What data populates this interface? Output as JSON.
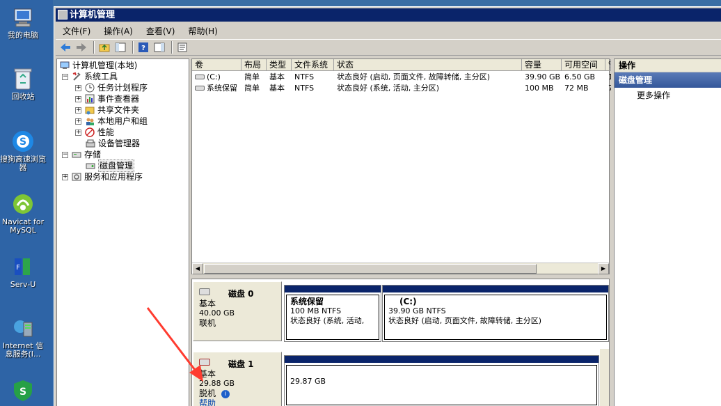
{
  "desktop": {
    "icons": [
      {
        "label": "我的电脑",
        "icon": "computer-icon"
      },
      {
        "label": "回收站",
        "icon": "recycle-bin-icon"
      },
      {
        "label": "搜狗高速浏览器",
        "icon": "sogou-browser-icon"
      },
      {
        "label": "Navicat for MySQL",
        "icon": "navicat-icon"
      },
      {
        "label": "Serv-U",
        "icon": "servu-icon"
      },
      {
        "label": "Internet 信息服务(I...",
        "icon": "iis-icon"
      },
      {
        "label": "",
        "icon": "security-shield-icon"
      }
    ]
  },
  "window": {
    "title": "计算机管理",
    "menu": [
      "文件(F)",
      "操作(A)",
      "查看(V)",
      "帮助(H)"
    ]
  },
  "tree": {
    "root": "计算机管理(本地)",
    "items": [
      {
        "label": "系统工具",
        "level": 1,
        "expander": "⊟"
      },
      {
        "label": "任务计划程序",
        "level": 2,
        "expander": "⊞"
      },
      {
        "label": "事件查看器",
        "level": 2,
        "expander": "⊞"
      },
      {
        "label": "共享文件夹",
        "level": 2,
        "expander": "⊞"
      },
      {
        "label": "本地用户和组",
        "level": 2,
        "expander": "⊞"
      },
      {
        "label": "性能",
        "level": 2,
        "expander": "⊞"
      },
      {
        "label": "设备管理器",
        "level": 2,
        "expander": ""
      },
      {
        "label": "存储",
        "level": 1,
        "expander": "⊟"
      },
      {
        "label": "磁盘管理",
        "level": 2,
        "expander": ""
      },
      {
        "label": "服务和应用程序",
        "level": 1,
        "expander": "⊞"
      }
    ]
  },
  "volumes": {
    "columns": [
      "卷",
      "布局",
      "类型",
      "文件系统",
      "状态",
      "容量",
      "可用空间",
      "%"
    ],
    "rows": [
      {
        "vol": "(C:)",
        "layout": "简单",
        "type": "基本",
        "fs": "NTFS",
        "status": "状态良好 (启动, 页面文件, 故障转储, 主分区)",
        "capacity": "39.90 GB",
        "free": "6.50 GB",
        "pct": "1"
      },
      {
        "vol": "系统保留",
        "layout": "简单",
        "type": "基本",
        "fs": "NTFS",
        "status": "状态良好 (系统, 活动, 主分区)",
        "capacity": "100 MB",
        "free": "72 MB",
        "pct": "7"
      }
    ]
  },
  "disks": [
    {
      "name": "磁盘 0",
      "type": "基本",
      "size": "40.00 GB",
      "state": "联机",
      "partitions": [
        {
          "title": "系统保留",
          "size": "100 MB NTFS",
          "status": "状态良好 (系统, 活动,"
        },
        {
          "title": "(C:)",
          "size": "39.90 GB NTFS",
          "status": "状态良好 (启动, 页面文件, 故障转储, 主分区)"
        }
      ]
    },
    {
      "name": "磁盘 1",
      "type": "基本",
      "size": "29.88 GB",
      "state": "脱机",
      "help": "帮助",
      "partitions": [
        {
          "title": "",
          "size": "29.87 GB",
          "status": ""
        }
      ]
    }
  ],
  "actions": {
    "header": "操作",
    "section": "磁盘管理",
    "items": [
      "更多操作"
    ]
  },
  "colors": {
    "title_bar": "#0a246a",
    "partition_bar": "#0a246a",
    "annotation_arrow": "#ff3b2f"
  }
}
